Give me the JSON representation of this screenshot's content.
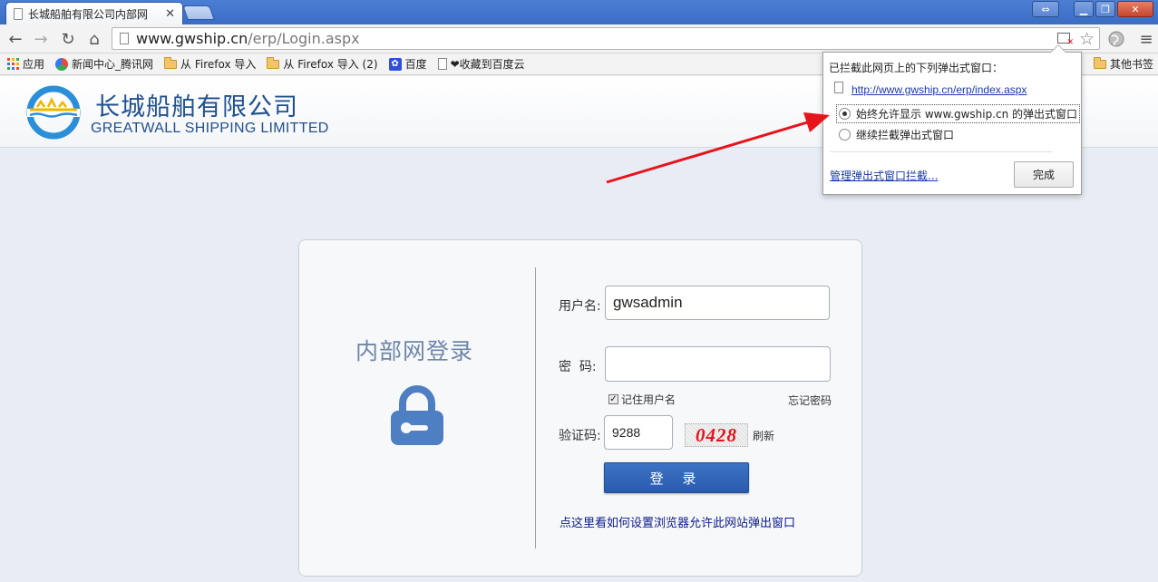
{
  "browser": {
    "tab_title": "长城船舶有限公司内部网",
    "url_host": "www.gwship.cn",
    "url_path": "/erp/Login.aspx",
    "bookmarks": [
      {
        "label": "应用",
        "icon": "apps-icon"
      },
      {
        "label": "新闻中心_腾讯网",
        "icon": "tencent-icon"
      },
      {
        "label": "从 Firefox 导入",
        "icon": "folder-icon"
      },
      {
        "label": "从 Firefox 导入 (2)",
        "icon": "folder-icon"
      },
      {
        "label": "百度",
        "icon": "baidu-icon"
      },
      {
        "label": "❤收藏到百度云",
        "icon": "doc-icon"
      }
    ],
    "other_bookmarks": "其他书签"
  },
  "header": {
    "company_cn": "长城船舶有限公司",
    "company_en": "GREATWALL SHIPPING LIMITTED"
  },
  "login": {
    "title": "内部网登录",
    "username_label": "用户名:",
    "username_value": "gwsadmin",
    "password_label": "密  码:",
    "password_value": "",
    "remember_label": "记住用户名",
    "remember_checked": true,
    "forgot_label": "忘记密码",
    "captcha_label": "验证码:",
    "captcha_value": "9288",
    "captcha_image_text": "0428",
    "refresh_label": "刷新",
    "submit_label": "登 录",
    "help_link": "点这里看如何设置浏览器允许此网站弹出窗口"
  },
  "popup_bubble": {
    "title": "已拦截此网页上的下列弹出式窗口：",
    "blocked_url": "http://www.gwship.cn/erp/index.aspx",
    "option_allow": "始终允许显示 www.gwship.cn 的弹出式窗口",
    "option_block": "继续拦截弹出式窗口",
    "selected_option": "option_allow",
    "manage_link": "管理弹出式窗口拦截...",
    "done_label": "完成"
  },
  "colors": {
    "brand_blue": "#1f4f8f",
    "button_blue": "#2a5cae",
    "arrow_red": "#e8141c",
    "captcha_red": "#e0141e"
  }
}
